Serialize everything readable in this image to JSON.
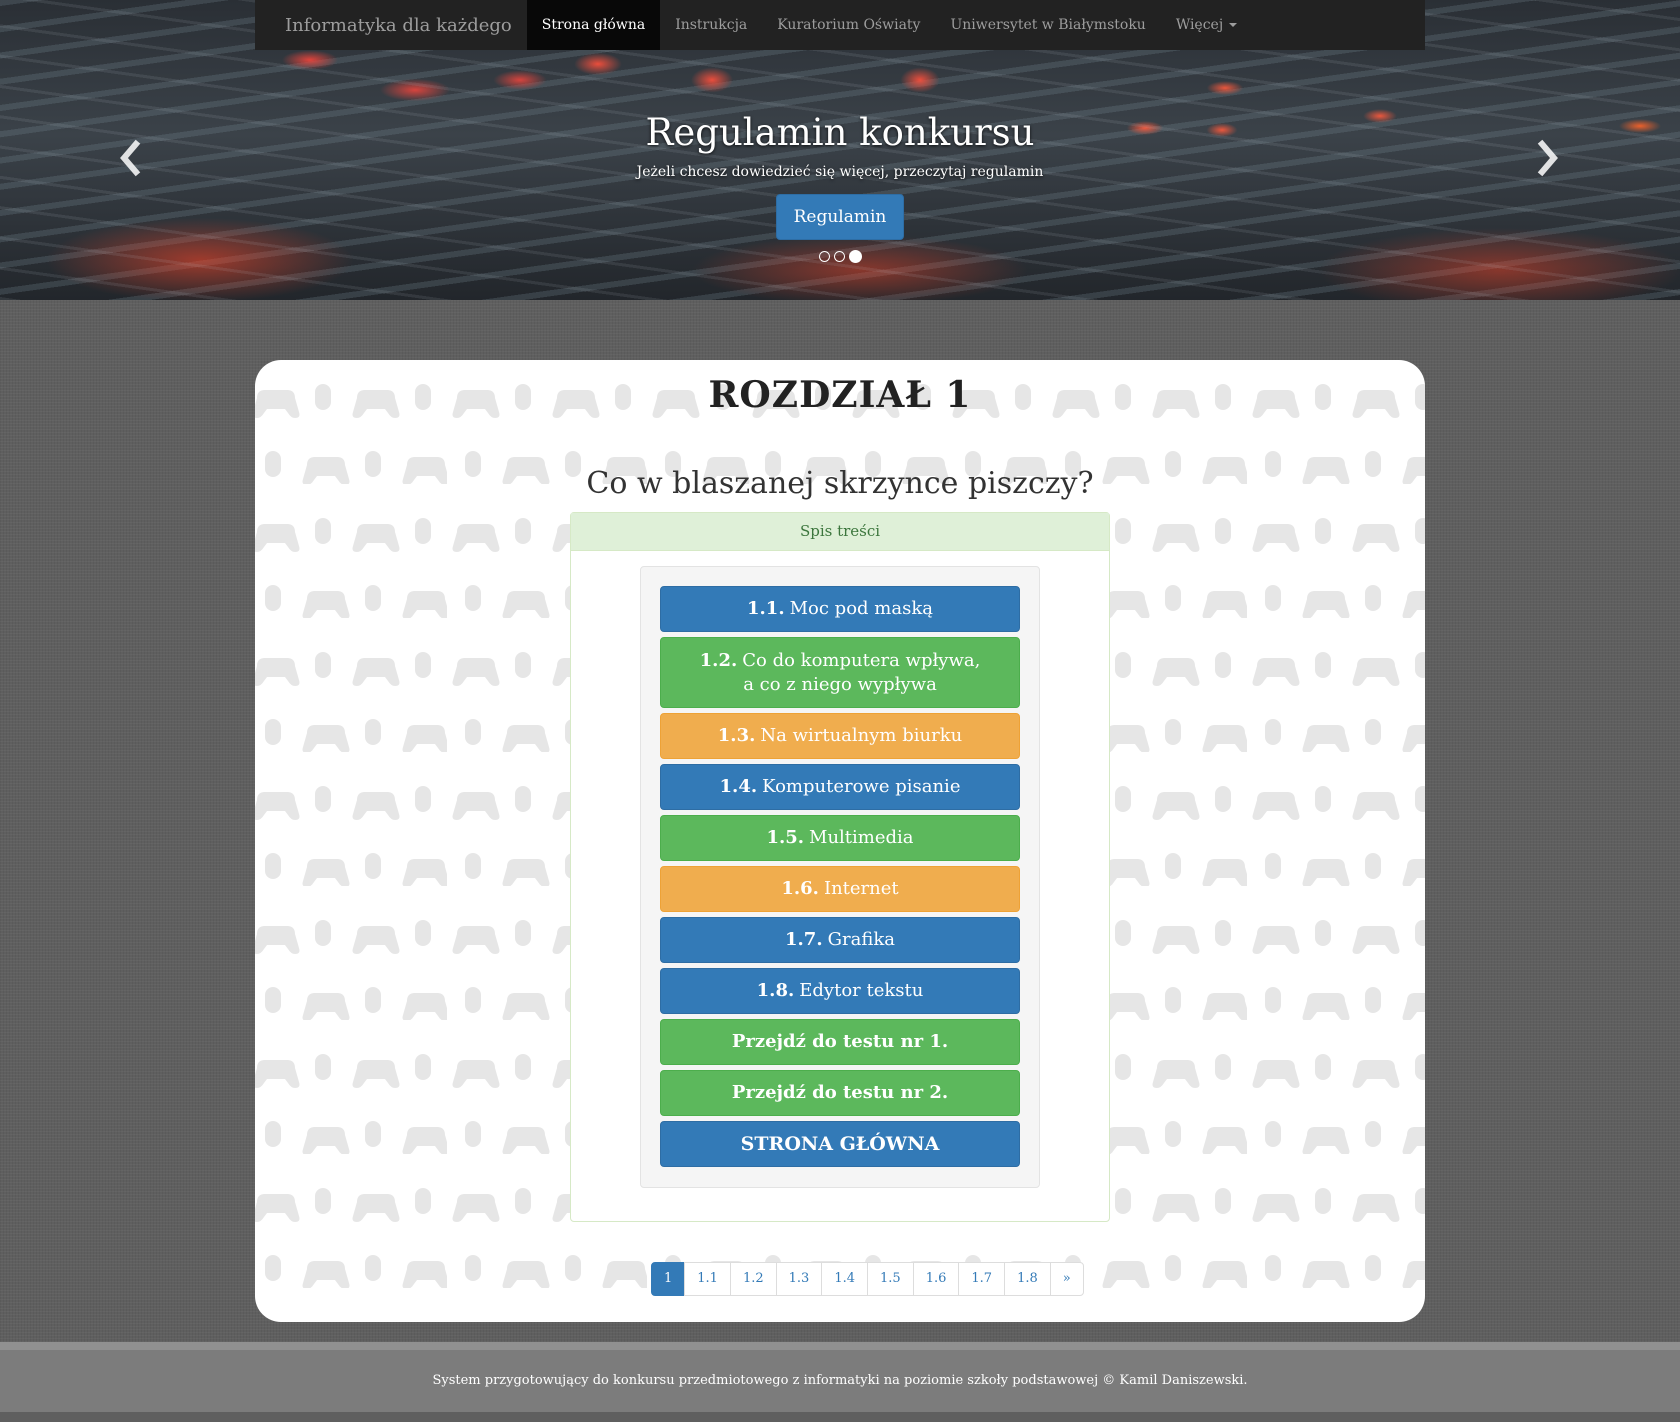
{
  "navbar": {
    "brand": "Informatyka dla każdego",
    "items": [
      {
        "label": "Strona główna",
        "active": true
      },
      {
        "label": "Instrukcja"
      },
      {
        "label": "Kuratorium Oświaty"
      },
      {
        "label": "Uniwersytet w Białymstoku"
      },
      {
        "label": "Więcej",
        "dropdown": true
      }
    ]
  },
  "carousel": {
    "title": "Regulamin konkursu",
    "text": "Jeżeli chcesz dowiedzieć się więcej, przeczytaj regulamin",
    "button": "Regulamin",
    "slides": 3,
    "active_slide": 3,
    "prev_icon": "chevron-left-icon",
    "next_icon": "chevron-right-icon"
  },
  "content": {
    "chapter": "ROZDZIAŁ 1",
    "subtitle": "Co w blaszanej skrzynce piszczy?",
    "toc_heading": "Spis treści",
    "toc": [
      {
        "num": "1.1.",
        "label": "Moc pod maską",
        "color": "blue"
      },
      {
        "num": "1.2.",
        "label": "Co do komputera wpływa,",
        "label2": "a co z niego wypływa",
        "color": "green"
      },
      {
        "num": "1.3.",
        "label": "Na wirtualnym biurku",
        "color": "orange"
      },
      {
        "num": "1.4.",
        "label": "Komputerowe pisanie",
        "color": "blue"
      },
      {
        "num": "1.5.",
        "label": "Multimedia",
        "color": "green"
      },
      {
        "num": "1.6.",
        "label": "Internet",
        "color": "orange"
      },
      {
        "num": "1.7.",
        "label": "Grafika",
        "color": "blue"
      },
      {
        "num": "1.8.",
        "label": "Edytor tekstu",
        "color": "blue"
      }
    ],
    "test1": "Przejdź do testu nr 1.",
    "test2": "Przejdź do testu nr 2.",
    "home": "STRONA GŁÓWNA"
  },
  "pagination": [
    "1",
    "1.1",
    "1.2",
    "1.3",
    "1.4",
    "1.5",
    "1.6",
    "1.7",
    "1.8",
    "»"
  ],
  "footer": "System przygotowujący do konkursu przedmiotowego z informatyki na poziomie szkoły podstawowej © Kamil Daniszewski.",
  "colors": {
    "navbar": "#222222",
    "primary": "#337ab7",
    "success": "#5cb85c",
    "warning": "#f0ad4e",
    "panel_heading": "#dff0d8"
  }
}
